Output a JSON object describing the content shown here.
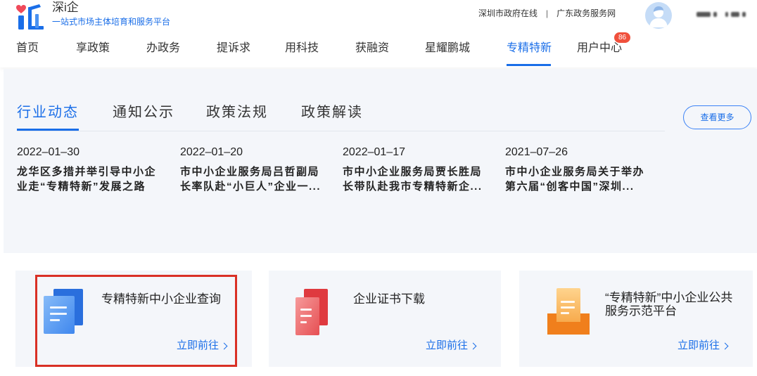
{
  "header": {
    "brand_name": "深i企",
    "brand_tagline": "一站式市场主体培育和服务平台",
    "links": [
      {
        "label": "深圳市政府在线"
      },
      {
        "label": "广东政务服务网"
      }
    ],
    "separator": "|",
    "logo_icon": "logo-icon",
    "avatar_icon": "user-icon"
  },
  "nav": {
    "items": [
      {
        "label": "首页"
      },
      {
        "label": "享政策"
      },
      {
        "label": "办政务"
      },
      {
        "label": "提诉求"
      },
      {
        "label": "用科技"
      },
      {
        "label": "获融资"
      },
      {
        "label": "星耀鹏城"
      },
      {
        "label": "专精特新"
      },
      {
        "label": "用户中心"
      }
    ],
    "active": "专精特新",
    "user_center_badge": "86"
  },
  "news": {
    "tabs": [
      {
        "label": "行业动态"
      },
      {
        "label": "通知公示"
      },
      {
        "label": "政策法规"
      },
      {
        "label": "政策解读"
      }
    ],
    "active_tab": "行业动态",
    "more_label": "查看更多",
    "items": [
      {
        "date": "2022–01–30",
        "title": "龙华区多措并举引导中小企\n业走“专精特新”发展之路"
      },
      {
        "date": "2022–01–20",
        "title": "市中小企业服务局吕哲副局\n长率队赴“小巨人”企业一..."
      },
      {
        "date": "2022–01–17",
        "title": "市中小企业服务局贾长胜局\n长带队赴我市专精特新企..."
      },
      {
        "date": "2021–07–26",
        "title": "市中小企业服务局关于举办\n第六届“创客中国”深圳..."
      }
    ]
  },
  "services": [
    {
      "title": "专精特新中小企业查询",
      "link_label": "立即前往",
      "icon": "document-blue-icon",
      "highlighted": true
    },
    {
      "title": "企业证书下载",
      "link_label": "立即前往",
      "icon": "document-red-icon"
    },
    {
      "title": "“专精特新”中小企业公共\n服务示范平台",
      "link_label": "立即前往",
      "icon": "document-tray-orange-icon"
    }
  ],
  "colors": {
    "accent": "#1a6ee8",
    "badge": "#f0503c",
    "panel_bg": "#f4f6fa",
    "highlight": "#d93025"
  }
}
